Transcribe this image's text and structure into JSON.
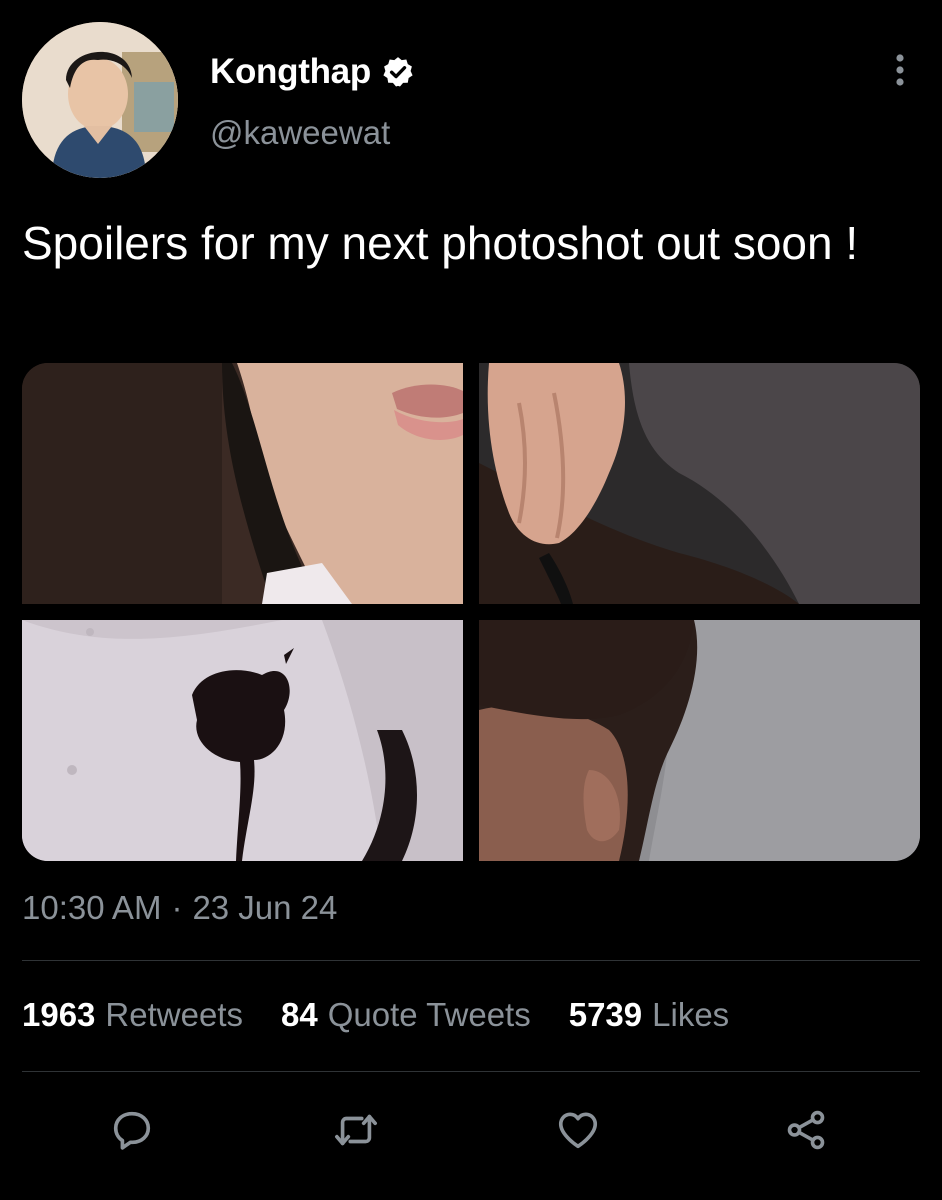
{
  "author": {
    "display_name": "Kongthap",
    "handle": "@kaweewat",
    "verified": true
  },
  "tweet": {
    "text": "Spoilers for my next photoshot out soon !",
    "time": "10:30 AM",
    "separator": "·",
    "date": "23 Jun 24",
    "media_count": 4
  },
  "stats": {
    "retweets": {
      "count": "1963",
      "label": "Retweets"
    },
    "quote_tweets": {
      "count": "84",
      "label": "Quote Tweets"
    },
    "likes": {
      "count": "5739",
      "label": "Likes"
    }
  },
  "actions": [
    "reply-icon",
    "retweet-icon",
    "like-icon",
    "share-icon"
  ],
  "colors": {
    "background": "#000000",
    "primary_text": "#ffffff",
    "secondary_text": "#8b9299",
    "divider": "#2f3336"
  }
}
